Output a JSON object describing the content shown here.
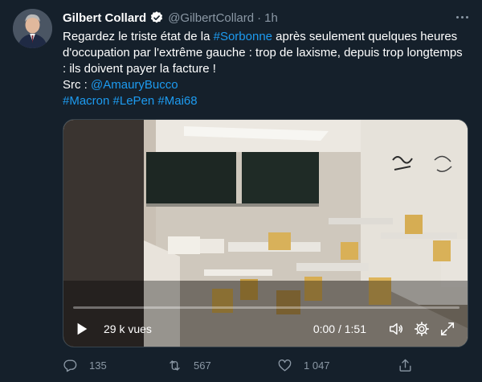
{
  "user": {
    "name": "Gilbert Collard",
    "handle": "@GilbertCollard",
    "separator": "·",
    "time": "1h"
  },
  "tweet": {
    "line1_pre": "Regardez le triste état de la ",
    "line1_tag": "#Sorbonne",
    "line1_post": " après seulement quelques heures",
    "line2": "d'occupation par l'extrême gauche : trop de laxisme, depuis trop longtemps",
    "line3": ": ils doivent payer la facture !",
    "src_label": "Src : ",
    "src_mention": "@AmauryBucco",
    "hashtag1": "#Macron",
    "hashtag2": "#LePen",
    "hashtag3": "#Mai68"
  },
  "video": {
    "views": "29 k vues",
    "time": "0:00 / 1:51",
    "progress": 0.0
  },
  "actions": {
    "replies": "135",
    "retweets": "567",
    "likes": "1 047"
  },
  "colors": {
    "background": "#15202b",
    "link": "#1d9bf0",
    "secondary": "#8b98a5",
    "verified": "#1d9bf0"
  }
}
